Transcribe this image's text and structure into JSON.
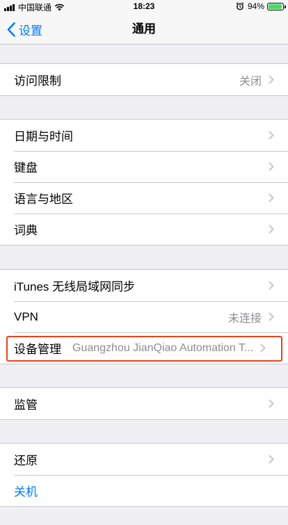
{
  "status_bar": {
    "carrier": "中国联通",
    "time": "18:23",
    "battery_percent": "94%",
    "battery_level": 0.94
  },
  "nav": {
    "back_label": "设置",
    "title": "通用"
  },
  "groups": [
    [
      {
        "label": "访问限制",
        "value": "关闭"
      }
    ],
    [
      {
        "label": "日期与时间"
      },
      {
        "label": "键盘"
      },
      {
        "label": "语言与地区"
      },
      {
        "label": "词典"
      }
    ],
    [
      {
        "label": "iTunes 无线局域网同步"
      },
      {
        "label": "VPN",
        "value": "未连接"
      },
      {
        "label": "设备管理",
        "value": "Guangzhou JianQiao Automation T..."
      }
    ],
    [
      {
        "label": "监管"
      }
    ],
    [
      {
        "label": "还原"
      },
      {
        "label": "关机"
      }
    ]
  ],
  "colors": {
    "accent": "#007aff",
    "highlight": "#e8421f",
    "background": "#efeff4"
  }
}
